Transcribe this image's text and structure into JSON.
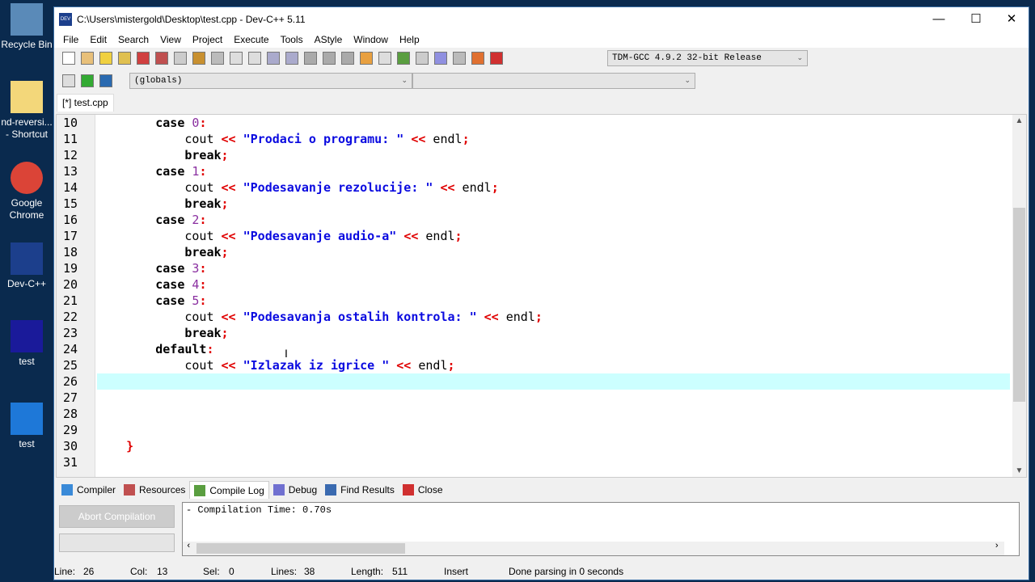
{
  "desktop": [
    {
      "label": "Recycle Bin",
      "icon": "recycle-bin-icon"
    },
    {
      "label": "nd-reversi... - Shortcut",
      "icon": "folder-shortcut-icon"
    },
    {
      "label": "Google Chrome",
      "icon": "chrome-icon"
    },
    {
      "label": "Dev-C++",
      "icon": "devcpp-icon"
    },
    {
      "label": "test",
      "icon": "cpp-file-icon"
    },
    {
      "label": "test",
      "icon": "exe-file-icon"
    }
  ],
  "window": {
    "title": "C:\\Users\\mistergold\\Desktop\\test.cpp - Dev-C++ 5.11"
  },
  "menu": [
    "File",
    "Edit",
    "Search",
    "View",
    "Project",
    "Execute",
    "Tools",
    "AStyle",
    "Window",
    "Help"
  ],
  "toolbar": {
    "compiler_select": "TDM-GCC 4.9.2 32-bit Release",
    "scope_select": "(globals)",
    "member_select": ""
  },
  "file_tab": "[*] test.cpp",
  "editor": {
    "lines": [
      {
        "n": "10",
        "t": [
          [
            "        ",
            ""
          ],
          [
            "case",
            "k"
          ],
          [
            " ",
            ""
          ],
          [
            "0",
            "n"
          ],
          [
            ":",
            "p"
          ]
        ]
      },
      {
        "n": "11",
        "t": [
          [
            "            cout ",
            ""
          ],
          [
            "<<",
            "p"
          ],
          [
            " ",
            ""
          ],
          [
            "\"Prodaci o programu: \"",
            "s"
          ],
          [
            " ",
            ""
          ],
          [
            "<<",
            "p"
          ],
          [
            " endl",
            ""
          ],
          [
            ";",
            "p"
          ]
        ]
      },
      {
        "n": "12",
        "t": [
          [
            "            ",
            ""
          ],
          [
            "break",
            "k"
          ],
          [
            ";",
            "p"
          ]
        ]
      },
      {
        "n": "13",
        "t": [
          [
            "        ",
            ""
          ],
          [
            "case",
            "k"
          ],
          [
            " ",
            ""
          ],
          [
            "1",
            "n"
          ],
          [
            ":",
            "p"
          ]
        ]
      },
      {
        "n": "14",
        "t": [
          [
            "            cout ",
            ""
          ],
          [
            "<<",
            "p"
          ],
          [
            " ",
            ""
          ],
          [
            "\"Podesavanje rezolucije: \"",
            "s"
          ],
          [
            " ",
            ""
          ],
          [
            "<<",
            "p"
          ],
          [
            " endl",
            ""
          ],
          [
            ";",
            "p"
          ]
        ]
      },
      {
        "n": "15",
        "t": [
          [
            "            ",
            ""
          ],
          [
            "break",
            "k"
          ],
          [
            ";",
            "p"
          ]
        ]
      },
      {
        "n": "16",
        "t": [
          [
            "        ",
            ""
          ],
          [
            "case",
            "k"
          ],
          [
            " ",
            ""
          ],
          [
            "2",
            "n"
          ],
          [
            ":",
            "p"
          ]
        ]
      },
      {
        "n": "17",
        "t": [
          [
            "            cout ",
            ""
          ],
          [
            "<<",
            "p"
          ],
          [
            " ",
            ""
          ],
          [
            "\"Podesavanje audio-a\"",
            "s"
          ],
          [
            " ",
            ""
          ],
          [
            "<<",
            "p"
          ],
          [
            " endl",
            ""
          ],
          [
            ";",
            "p"
          ]
        ]
      },
      {
        "n": "18",
        "t": [
          [
            "            ",
            ""
          ],
          [
            "break",
            "k"
          ],
          [
            ";",
            "p"
          ]
        ]
      },
      {
        "n": "19",
        "t": [
          [
            "        ",
            ""
          ],
          [
            "case",
            "k"
          ],
          [
            " ",
            ""
          ],
          [
            "3",
            "n"
          ],
          [
            ":",
            "p"
          ]
        ]
      },
      {
        "n": "20",
        "t": [
          [
            "        ",
            ""
          ],
          [
            "case",
            "k"
          ],
          [
            " ",
            ""
          ],
          [
            "4",
            "n"
          ],
          [
            ":",
            "p"
          ]
        ]
      },
      {
        "n": "21",
        "t": [
          [
            "        ",
            ""
          ],
          [
            "case",
            "k"
          ],
          [
            " ",
            ""
          ],
          [
            "5",
            "n"
          ],
          [
            ":",
            "p"
          ]
        ]
      },
      {
        "n": "22",
        "t": [
          [
            "            cout ",
            ""
          ],
          [
            "<<",
            "p"
          ],
          [
            " ",
            ""
          ],
          [
            "\"Podesavanja ostalih kontrola: \"",
            "s"
          ],
          [
            " ",
            ""
          ],
          [
            "<<",
            "p"
          ],
          [
            " endl",
            ""
          ],
          [
            ";",
            "p"
          ]
        ]
      },
      {
        "n": "23",
        "t": [
          [
            "            ",
            ""
          ],
          [
            "break",
            "k"
          ],
          [
            ";",
            "p"
          ]
        ]
      },
      {
        "n": "24",
        "t": [
          [
            "        ",
            ""
          ],
          [
            "default",
            "k"
          ],
          [
            ":",
            "p"
          ]
        ]
      },
      {
        "n": "25",
        "t": [
          [
            "            cout ",
            ""
          ],
          [
            "<<",
            "p"
          ],
          [
            " ",
            ""
          ],
          [
            "\"Izlazak iz igrice \"",
            "s"
          ],
          [
            " ",
            ""
          ],
          [
            "<<",
            "p"
          ],
          [
            " endl",
            ""
          ],
          [
            ";",
            "p"
          ]
        ]
      },
      {
        "n": "26",
        "t": [],
        "current": true
      },
      {
        "n": "27",
        "t": []
      },
      {
        "n": "28",
        "t": []
      },
      {
        "n": "29",
        "t": []
      },
      {
        "n": "30",
        "t": [
          [
            "    ",
            ""
          ],
          [
            "}",
            "p"
          ]
        ]
      },
      {
        "n": "31",
        "t": []
      }
    ]
  },
  "bottom_tabs": [
    {
      "label": "Compiler",
      "icon": "compiler-icon"
    },
    {
      "label": "Resources",
      "icon": "resources-icon"
    },
    {
      "label": "Compile Log",
      "icon": "compile-log-icon",
      "active": true
    },
    {
      "label": "Debug",
      "icon": "debug-check-icon"
    },
    {
      "label": "Find Results",
      "icon": "find-results-icon"
    },
    {
      "label": "Close",
      "icon": "close-panel-icon"
    }
  ],
  "abort_label": "Abort Compilation",
  "log": "- Compilation Time: 0.70s",
  "status": {
    "line_label": "Line:",
    "line": "26",
    "col_label": "Col:",
    "col": "13",
    "sel_label": "Sel:",
    "sel": "0",
    "lines_label": "Lines:",
    "lines": "38",
    "length_label": "Length:",
    "length": "511",
    "mode": "Insert",
    "message": "Done parsing in 0 seconds"
  },
  "colors": {
    "keyword": "#000000",
    "number": "#8a2fa0",
    "symbol": "#e00000",
    "string": "#0a0ae0",
    "current_line": "#ccffff"
  }
}
